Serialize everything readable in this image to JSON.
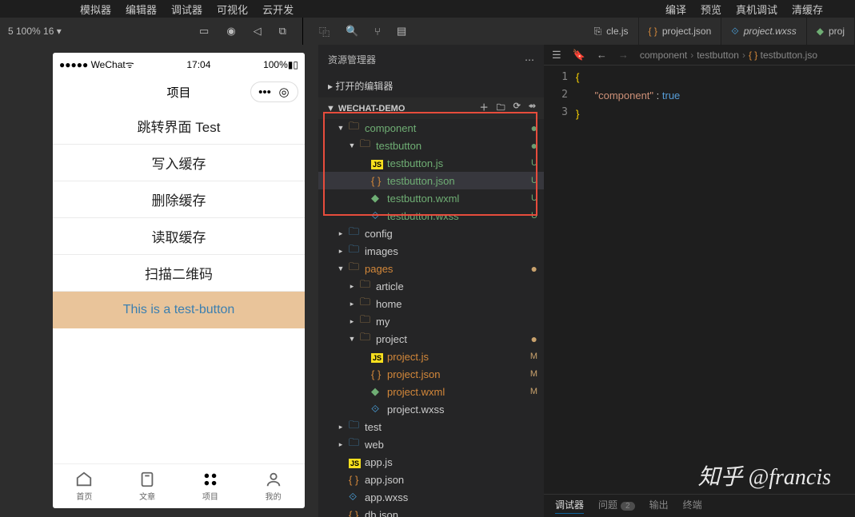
{
  "menu": {
    "left": [
      "模拟器",
      "编辑器",
      "调试器",
      "可视化",
      "云开发"
    ],
    "right": [
      "编译",
      "预览",
      "真机调试",
      "清缓存"
    ]
  },
  "toolbar": {
    "zoom": "5 100% 16 ▾"
  },
  "tabs": {
    "cle": "cle.js",
    "pjson": "project.json",
    "pwxss": "project.wxss",
    "proj": "proj"
  },
  "sim": {
    "carrier": "●●●●● WeChat",
    "time": "17:04",
    "batt": "100%",
    "title": "项目",
    "items": [
      "跳转界面 Test",
      "写入缓存",
      "删除缓存",
      "读取缓存",
      "扫描二维码"
    ],
    "testbtn": "This is a test-button",
    "tabbar": [
      "首页",
      "文章",
      "项目",
      "我的"
    ]
  },
  "explorer": {
    "title": "资源管理器",
    "open": "打开的编辑器",
    "proj": "WECHAT-DEMO",
    "tree": [
      {
        "d": 1,
        "t": "folder",
        "arrow": "▼",
        "name": "component",
        "cls": "green",
        "stat": "●",
        "sc": "dotM"
      },
      {
        "d": 2,
        "t": "folder",
        "arrow": "▼",
        "name": "testbutton",
        "cls": "green",
        "stat": "●",
        "sc": "dotM"
      },
      {
        "d": 3,
        "t": "js",
        "name": "testbutton.js",
        "cls": "green",
        "stat": "U",
        "sc": "statU"
      },
      {
        "d": 3,
        "t": "json",
        "name": "testbutton.json",
        "cls": "green",
        "stat": "U",
        "sc": "statU",
        "sel": true
      },
      {
        "d": 3,
        "t": "wxml",
        "name": "testbutton.wxml",
        "cls": "green",
        "stat": "U",
        "sc": "statU"
      },
      {
        "d": 3,
        "t": "wxss",
        "name": "testbutton.wxss",
        "cls": "green",
        "stat": "U",
        "sc": "statU"
      },
      {
        "d": 1,
        "t": "fx",
        "arrow": "▸",
        "name": "config"
      },
      {
        "d": 1,
        "t": "fx",
        "arrow": "▸",
        "name": "images"
      },
      {
        "d": 1,
        "t": "folder",
        "arrow": "▼",
        "name": "pages",
        "cls": "orange",
        "stat": "●",
        "sc": "dotO"
      },
      {
        "d": 2,
        "t": "folder",
        "arrow": "▸",
        "name": "article"
      },
      {
        "d": 2,
        "t": "folder",
        "arrow": "▸",
        "name": "home"
      },
      {
        "d": 2,
        "t": "folder",
        "arrow": "▸",
        "name": "my"
      },
      {
        "d": 2,
        "t": "folder",
        "arrow": "▼",
        "name": "project",
        "stat": "●",
        "sc": "dotO"
      },
      {
        "d": 3,
        "t": "js",
        "name": "project.js",
        "cls": "orange",
        "stat": "M",
        "sc": "statM"
      },
      {
        "d": 3,
        "t": "json",
        "name": "project.json",
        "cls": "orange",
        "stat": "M",
        "sc": "statM"
      },
      {
        "d": 3,
        "t": "wxml",
        "name": "project.wxml",
        "cls": "orange",
        "stat": "M",
        "sc": "statM"
      },
      {
        "d": 3,
        "t": "wxss",
        "name": "project.wxss"
      },
      {
        "d": 1,
        "t": "fx",
        "arrow": "▸",
        "name": "test"
      },
      {
        "d": 1,
        "t": "fx",
        "arrow": "▸",
        "name": "web"
      },
      {
        "d": 1,
        "t": "js",
        "name": "app.js"
      },
      {
        "d": 1,
        "t": "json",
        "name": "app.json"
      },
      {
        "d": 1,
        "t": "wxss",
        "name": "app.wxss"
      },
      {
        "d": 1,
        "t": "json",
        "name": "db.json"
      }
    ]
  },
  "crumb": [
    "component",
    "testbutton",
    "testbutton.jso"
  ],
  "code": {
    "l1": "{",
    "l2k": "\"component\"",
    "l2c": " : ",
    "l2v": "true",
    "l3": "}"
  },
  "bottom": {
    "t1": "调试器",
    "t2": "问题",
    "t2b": "2",
    "t3": "输出",
    "t4": "终端"
  },
  "wmark": "知乎 @francis"
}
